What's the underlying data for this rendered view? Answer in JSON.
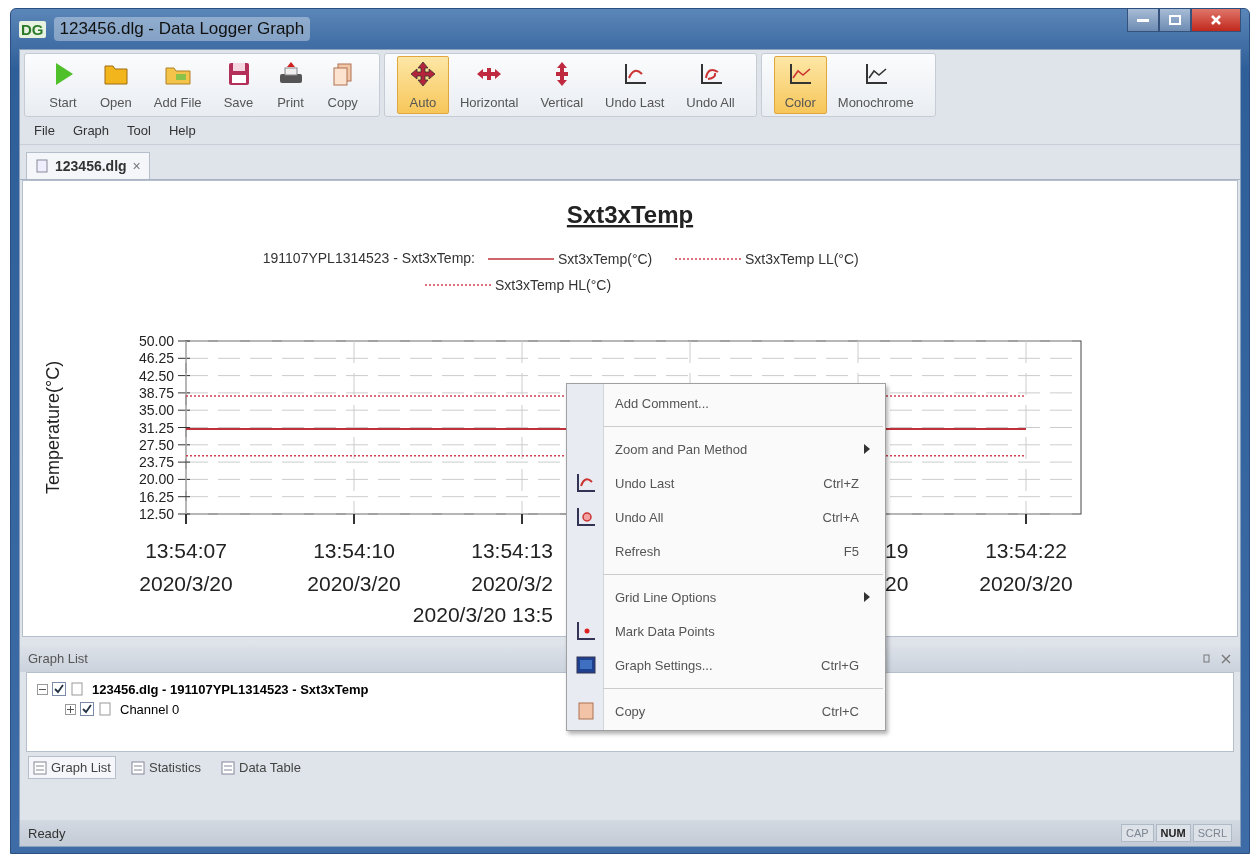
{
  "window": {
    "logo": "DG",
    "title": "123456.dlg - Data Logger Graph"
  },
  "toolbar": {
    "groups": [
      {
        "items": [
          {
            "label": "Start"
          },
          {
            "label": "Open"
          },
          {
            "label": "Add File"
          },
          {
            "label": "Save"
          },
          {
            "label": "Print"
          },
          {
            "label": "Copy"
          }
        ]
      },
      {
        "items": [
          {
            "label": "Auto",
            "selected": true
          },
          {
            "label": "Horizontal",
            "selected": false
          },
          {
            "label": "Vertical",
            "selected": false
          },
          {
            "label": "Undo Last"
          },
          {
            "label": "Undo All"
          }
        ]
      },
      {
        "items": [
          {
            "label": "Color",
            "selected": true
          },
          {
            "label": "Monochrome",
            "selected": false
          }
        ]
      }
    ]
  },
  "menu_bar": [
    "File",
    "Graph",
    "Tool",
    "Help"
  ],
  "document_tabs": [
    {
      "label": "123456.dlg",
      "close": "×",
      "selected": true
    }
  ],
  "graph": {
    "title": "Sxt3xTemp",
    "legend_prefix": "191107YPL1314523 - Sxt3xTemp:",
    "chart_data": {
      "type": "line",
      "ylabel": "Temperature(°C)",
      "xlabel": "2020/3/20 13:5",
      "ylim": [
        12.5,
        50
      ],
      "grid": true,
      "legend": "top",
      "categories": [
        "13:54:07\n2020/3/20",
        "13:54:10\n2020/3/20",
        "13:54:13\n2020/3/2",
        null,
        "19\n20",
        "13:54:22\n2020/3/20"
      ],
      "yticks": [
        {
          "value": 50,
          "label": "50.00"
        },
        {
          "value": 46.25,
          "label": "46.25"
        },
        {
          "value": 42.5,
          "label": "42.50"
        },
        {
          "value": 38.75,
          "label": "38.75"
        },
        {
          "value": 35,
          "label": "35.00"
        },
        {
          "value": 31.25,
          "label": "31.25"
        },
        {
          "value": 27.5,
          "label": "27.50"
        },
        {
          "value": 23.75,
          "label": "23.75"
        },
        {
          "value": 20,
          "label": "20.00"
        },
        {
          "value": 16.25,
          "label": "16.25"
        },
        {
          "value": 12.5,
          "label": "12.50"
        }
      ],
      "series": [
        {
          "name": "Sxt3xTemp(°C)",
          "color": "#c0303a",
          "line_style": "solid",
          "values": [
            30.9,
            30.9,
            30.9,
            null,
            null,
            30.9
          ]
        },
        {
          "name": "Sxt3xTemp LL(°C)",
          "color": "#d04050",
          "line_style": "dotted",
          "values": [
            25.1,
            25.1,
            25.1,
            null,
            null,
            25.1
          ]
        },
        {
          "name": "Sxt3xTemp HL(°C)",
          "color": "#d04050",
          "line_style": "dotted",
          "values": [
            38.1,
            38.1,
            38.1,
            null,
            null,
            38.1
          ]
        }
      ]
    }
  },
  "context_menu": [
    {
      "kind": "item",
      "label": "Add Comment..."
    },
    {
      "kind": "separator"
    },
    {
      "kind": "submenu",
      "label": "Zoom and Pan Method"
    },
    {
      "kind": "item",
      "label": "Undo Last",
      "shortcut": "Ctrl+Z"
    },
    {
      "kind": "item",
      "label": "Undo All",
      "shortcut": "Ctrl+A"
    },
    {
      "kind": "item",
      "label": "Refresh",
      "shortcut": "F5"
    },
    {
      "kind": "separator"
    },
    {
      "kind": "submenu",
      "label": "Grid Line Options"
    },
    {
      "kind": "item",
      "label": "Mark Data Points"
    },
    {
      "kind": "item",
      "label": "Graph Settings...",
      "shortcut": "Ctrl+G"
    },
    {
      "kind": "separator"
    },
    {
      "kind": "item",
      "label": "Copy",
      "shortcut": "Ctrl+C"
    }
  ],
  "graph_list": {
    "title": "Graph List",
    "tree": [
      {
        "label": "123456.dlg - 191107YPL1314523 - Sxt3xTemp",
        "checked": true,
        "expanded": true,
        "children": [
          {
            "label": "Channel 0",
            "checked": true,
            "expanded": false
          }
        ]
      }
    ]
  },
  "bottom_tabs": [
    {
      "label": "Graph List",
      "selected": true
    },
    {
      "label": "Statistics",
      "selected": false
    },
    {
      "label": "Data Table",
      "selected": false
    }
  ],
  "status_bar": {
    "text": "Ready",
    "indicators": [
      {
        "label": "CAP",
        "on": false
      },
      {
        "label": "NUM",
        "on": true
      },
      {
        "label": "SCRL",
        "on": false
      }
    ]
  }
}
